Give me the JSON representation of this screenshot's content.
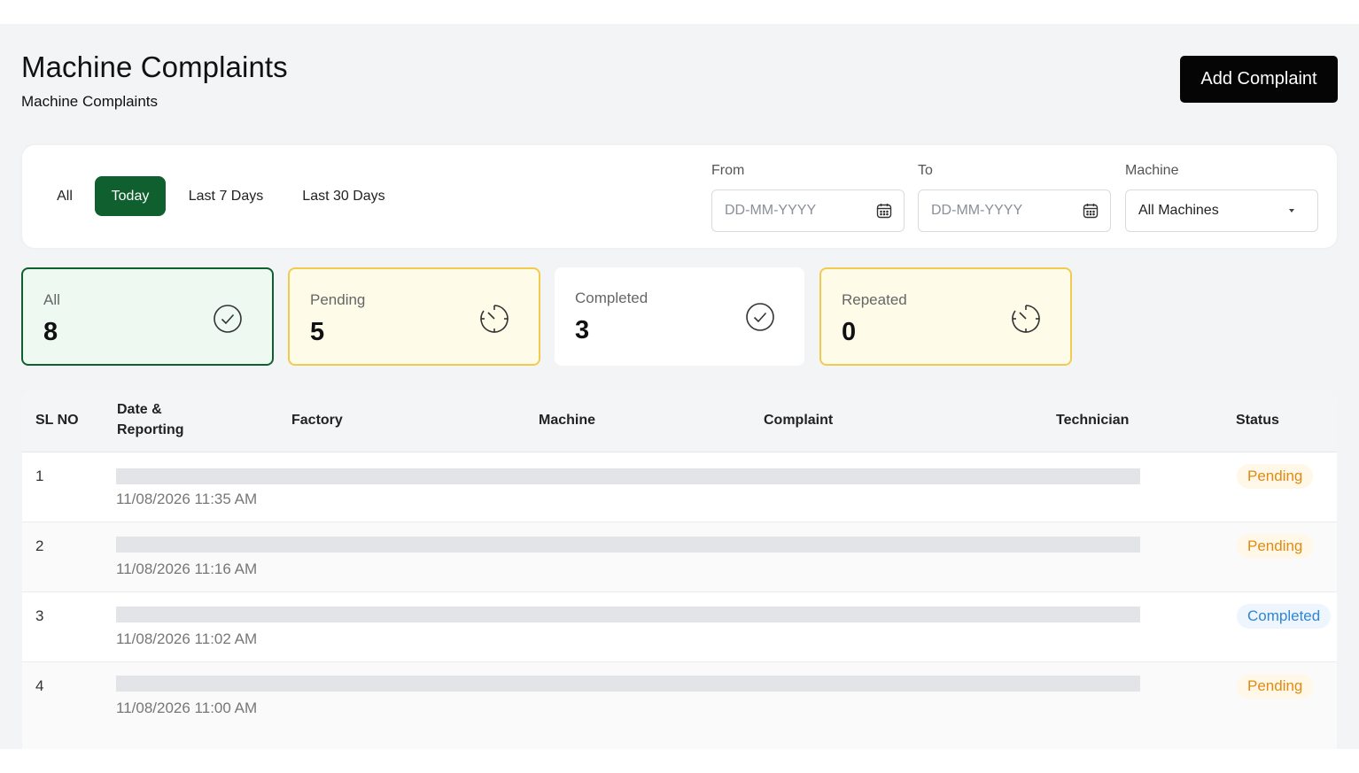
{
  "header": {
    "title": "Machine Complaints",
    "breadcrumb": "Machine Complaints",
    "add_button": "Add Complaint"
  },
  "filters": {
    "tabs": [
      {
        "label": "All",
        "active": false
      },
      {
        "label": "Today",
        "active": true
      },
      {
        "label": "Last 7 Days",
        "active": false
      },
      {
        "label": "Last 30 Days",
        "active": false
      }
    ],
    "from": {
      "label": "From",
      "placeholder": "DD-MM-YYYY",
      "icon": "calendar-icon"
    },
    "to": {
      "label": "To",
      "placeholder": "DD-MM-YYYY",
      "icon": "calendar-icon"
    },
    "machine": {
      "label": "Machine",
      "value": "All Machines",
      "icon": "caret-down-icon"
    }
  },
  "stats": [
    {
      "label": "All",
      "value": "8",
      "icon": "check-circle-icon",
      "bg": "#eef9f2",
      "border": "#0f5f2f"
    },
    {
      "label": "Pending",
      "value": "5",
      "icon": "timer-icon",
      "bg": "#fefbe9",
      "border": "#f1cb4f"
    },
    {
      "label": "Completed",
      "value": "3",
      "icon": "check-circle-icon",
      "bg": "#ffffff",
      "border": "#ffffff"
    },
    {
      "label": "Repeated",
      "value": "0",
      "icon": "timer-icon",
      "bg": "#fefbe9",
      "border": "#f1cb4f"
    }
  ],
  "table": {
    "headers": {
      "sl_no": "SL NO",
      "date_line1": "Date &",
      "date_line2": "Reporting",
      "factory": "Factory",
      "machine": "Machine",
      "complaint": "Complaint",
      "technician": "Technician",
      "status": "Status"
    },
    "rows": [
      {
        "no": "1",
        "date": "11/08/2026 11:35 AM",
        "status": "Pending"
      },
      {
        "no": "2",
        "date": "11/08/2026 11:16 AM",
        "status": "Pending"
      },
      {
        "no": "3",
        "date": "11/08/2026 11:02 AM",
        "status": "Completed"
      },
      {
        "no": "4",
        "date": "11/08/2026 11:00 AM",
        "status": "Pending"
      }
    ]
  },
  "colors": {
    "accent": "#0f5f2f",
    "pending": "#e08a12",
    "completed": "#2f86d6"
  }
}
